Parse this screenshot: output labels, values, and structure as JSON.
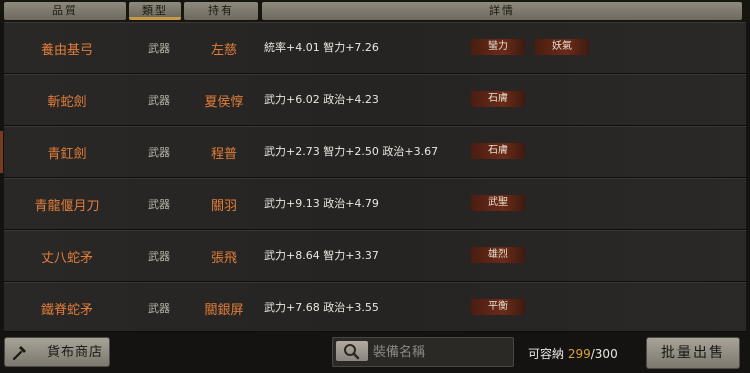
{
  "header": {
    "cols": [
      "品質",
      "類型",
      "持有",
      "詳情"
    ]
  },
  "rows": [
    {
      "name": "養由基弓",
      "type": "武器",
      "owner": "左慈",
      "stats": "統率+4.01  智力+7.26",
      "tags": [
        "蠻力",
        "妖氣"
      ]
    },
    {
      "name": "斬蛇劍",
      "type": "武器",
      "owner": "夏侯惇",
      "stats": "武力+6.02  政治+4.23",
      "tags": [
        "石膚"
      ]
    },
    {
      "name": "青釭劍",
      "type": "武器",
      "owner": "程普",
      "stats": "武力+2.73  智力+2.50  政治+3.67",
      "tags": [
        "石膚"
      ]
    },
    {
      "name": "青龍偃月刀",
      "type": "武器",
      "owner": "關羽",
      "stats": "武力+9.13  政治+4.79",
      "tags": [
        "武聖"
      ]
    },
    {
      "name": "丈八蛇矛",
      "type": "武器",
      "owner": "張飛",
      "stats": "武力+8.64  智力+3.37",
      "tags": [
        "雄烈"
      ]
    },
    {
      "name": "鐵脊蛇矛",
      "type": "武器",
      "owner": "關銀屏",
      "stats": "武力+7.68  政治+3.55",
      "tags": [
        "平衡"
      ]
    }
  ],
  "footer": {
    "shop_label": "貨布商店",
    "shop_icon": "hammer-icon",
    "search_icon": "magnifier-icon",
    "search_placeholder": "裝備名稱",
    "capacity_label": "可容納",
    "capacity_current": "299",
    "capacity_sep_total": "/300",
    "sell_label": "批量出售"
  }
}
